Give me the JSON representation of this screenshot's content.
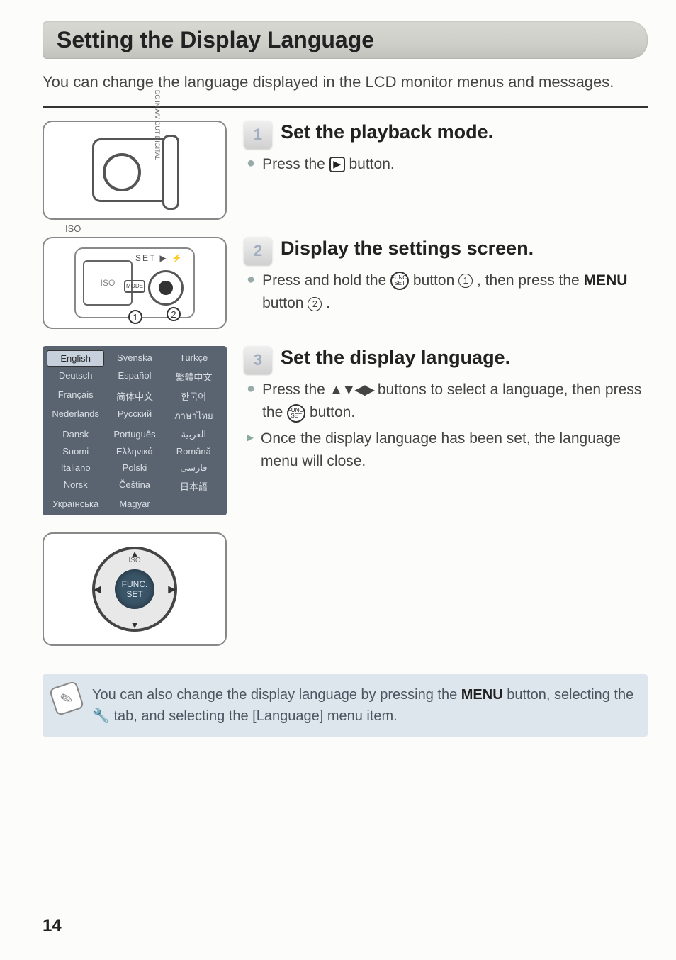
{
  "title": "Setting the Display Language",
  "intro": "You can change the language displayed in the LCD monitor menus and messages.",
  "steps": {
    "s1": {
      "num": "1",
      "title": "Set the playback mode.",
      "line1_pre": "Press the ",
      "play_icon": "▶",
      "line1_post": " button."
    },
    "s2": {
      "num": "2",
      "title": "Display the settings screen.",
      "line_pre": "Press and hold the ",
      "func_top": "FUNC.",
      "func_bot": "SET",
      "line_mid": " button ",
      "call1": "1",
      "line_mid2": " , then press the ",
      "menu_label": "MENU",
      "line_post": " button ",
      "call2": "2",
      "line_end": " ."
    },
    "s3": {
      "num": "3",
      "title": "Set the display language.",
      "l1_pre": "Press the ",
      "arrows": "▲▼◀▶",
      "l1_mid": " buttons to select a language, then press the ",
      "l1_post": " button.",
      "l2": "Once the display language has been set, the language menu will close."
    }
  },
  "illus": {
    "iso_label": "ISO",
    "port_label": "DC IN  A/V OUT  DIGITAL",
    "mode_label": "MODE",
    "top_icons": "SET ▶ ⚡",
    "screen_text": "ISO",
    "dial_func": "FUNC.",
    "dial_set": "SET"
  },
  "lang_menu": {
    "rows": [
      [
        "English",
        "Svenska",
        "Türkçe"
      ],
      [
        "Deutsch",
        "Español",
        "繁體中文"
      ],
      [
        "Français",
        "简体中文",
        "한국어"
      ],
      [
        "Nederlands",
        "Русский",
        "ภาษาไทย"
      ],
      [
        "Dansk",
        "Português",
        "العربية"
      ],
      [
        "Suomi",
        "Ελληνικά",
        "Română"
      ],
      [
        "Italiano",
        "Polski",
        "فارسی"
      ],
      [
        "Norsk",
        "Čeština",
        "日本語"
      ],
      [
        "Українська",
        "Magyar",
        ""
      ]
    ],
    "selected": "English"
  },
  "tip": {
    "pre": "You can also change the display language by pressing the ",
    "menu": "MENU",
    "mid": " button, selecting the ",
    "tab_icon": "🔧",
    "mid2": " tab, and selecting the [Language] menu item."
  },
  "page_number": "14"
}
